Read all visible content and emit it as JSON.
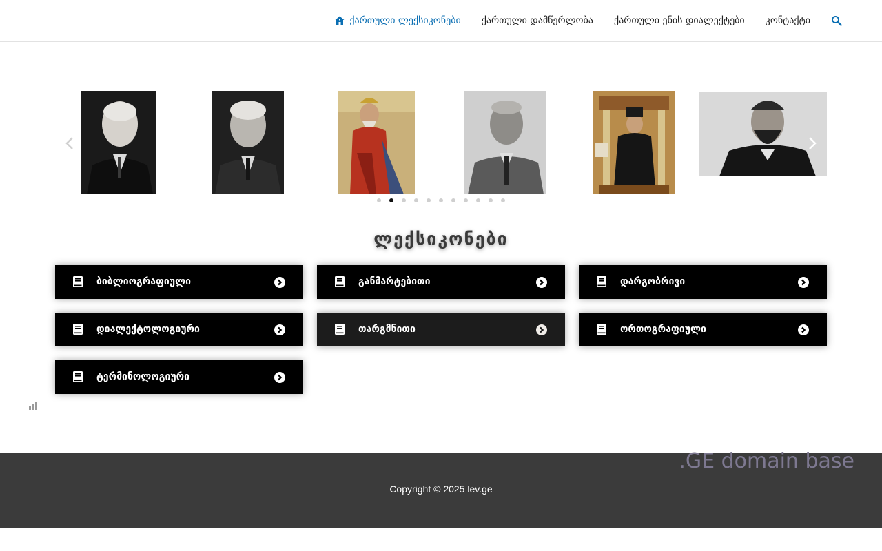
{
  "header": {
    "nav": [
      {
        "label": "ქართული ლექსიკონები",
        "active": true
      },
      {
        "label": "ქართული დამწერლობა",
        "active": false
      },
      {
        "label": "ქართული ენის დიალექტები",
        "active": false
      },
      {
        "label": "კონტაქტი",
        "active": false
      }
    ],
    "icons": {
      "home": "home-icon",
      "search": "search-icon"
    },
    "accent_color": "#0b6fb3"
  },
  "carousel": {
    "slides": [
      {
        "name": "portrait-1"
      },
      {
        "name": "portrait-2"
      },
      {
        "name": "portrait-3"
      },
      {
        "name": "portrait-4"
      },
      {
        "name": "portrait-5"
      },
      {
        "name": "portrait-6"
      }
    ],
    "dot_count": 11,
    "active_dot": 1
  },
  "dictionaries": {
    "title": "ლექსიკონები",
    "items": [
      {
        "label": "ბიბლიოგრაფიული"
      },
      {
        "label": "განმარტებითი"
      },
      {
        "label": "დარგობრივი"
      },
      {
        "label": "დიალექტოლოგიური"
      },
      {
        "label": "თარგმნითი"
      },
      {
        "label": "ორთოგრაფიული"
      },
      {
        "label": "ტერმინოლოგიური"
      }
    ]
  },
  "footer": {
    "watermark": ".GE domain base",
    "copyright": "Copyright © 2025 lev.ge",
    "background_color": "#3b3b3b"
  }
}
